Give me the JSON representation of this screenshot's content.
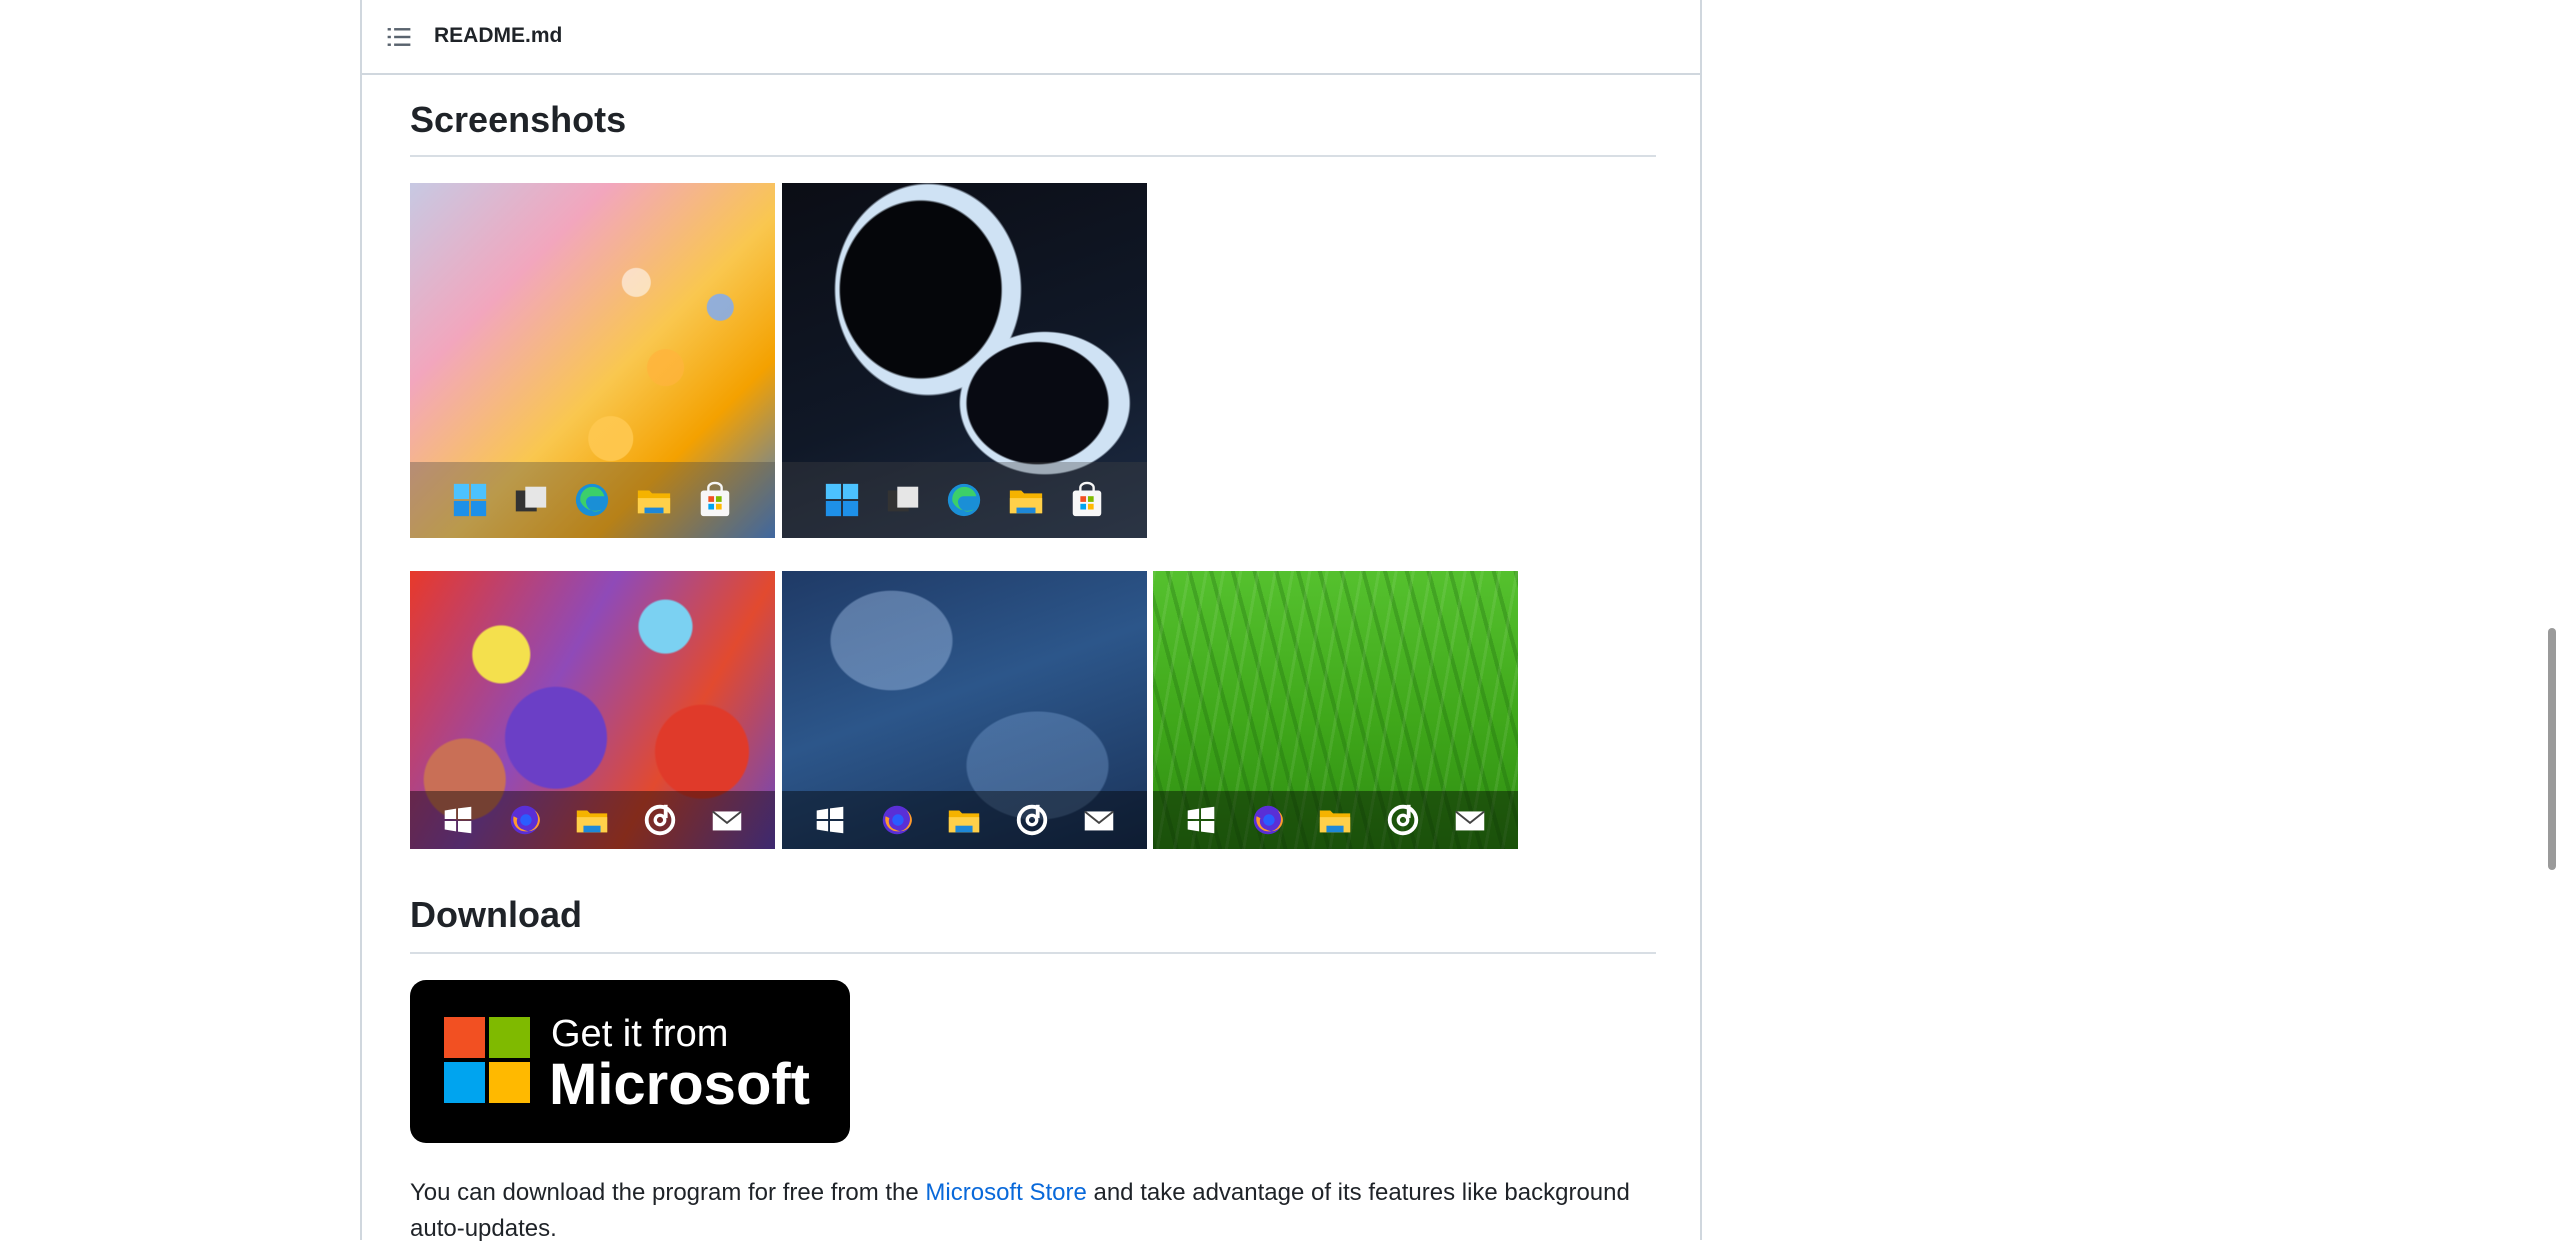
{
  "readme": {
    "filename": "README.md",
    "toc_icon": "list-unordered-icon"
  },
  "screenshots_section": {
    "heading": "Screenshots",
    "images": [
      {
        "name": "screenshot-win11-bubbles",
        "style": "Windows 11 taskbar",
        "icons": [
          "windows-start-icon",
          "task-view-icon",
          "edge-icon",
          "file-explorer-icon",
          "store-icon"
        ]
      },
      {
        "name": "screenshot-win11-dark-abstract",
        "style": "Windows 11 taskbar",
        "icons": [
          "windows-start-icon",
          "task-view-icon",
          "edge-icon",
          "file-explorer-icon",
          "store-icon"
        ]
      },
      {
        "name": "screenshot-win10-colorful",
        "style": "Windows 10 taskbar",
        "icons": [
          "windows-start-icon",
          "firefox-icon",
          "file-explorer-icon",
          "groove-icon",
          "mail-icon"
        ]
      },
      {
        "name": "screenshot-win10-space",
        "style": "Windows 10 taskbar",
        "icons": [
          "windows-start-icon",
          "firefox-icon",
          "file-explorer-icon",
          "groove-icon",
          "mail-icon"
        ]
      },
      {
        "name": "screenshot-win10-grass",
        "style": "Windows 10 taskbar",
        "icons": [
          "windows-start-icon",
          "firefox-icon",
          "file-explorer-icon",
          "groove-icon",
          "mail-icon"
        ]
      }
    ]
  },
  "download_section": {
    "heading": "Download",
    "badge": {
      "line1": "Get it from",
      "line2": "Microsoft",
      "logo_colors": [
        "#f25022",
        "#7fba00",
        "#00a4ef",
        "#ffb900"
      ]
    },
    "text_before_link": "You can download the program for free from the ",
    "link_text": "Microsoft Store",
    "text_after_link": " and take advantage of its features like background auto-updates."
  },
  "colors": {
    "link": "#0969da",
    "text": "#1f2328",
    "border": "#d0d7de"
  }
}
